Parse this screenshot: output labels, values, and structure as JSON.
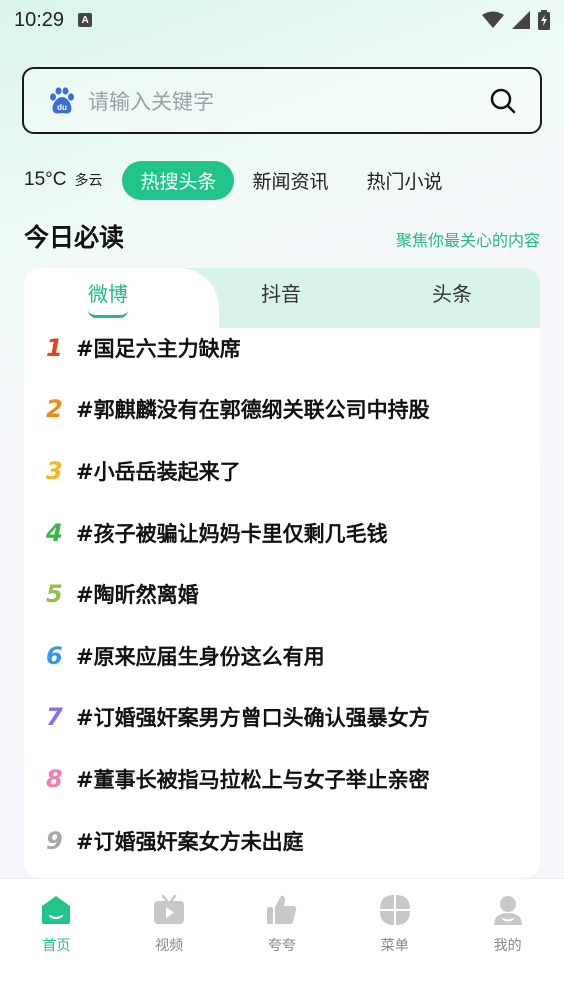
{
  "status": {
    "time": "10:29",
    "notif": "A"
  },
  "search": {
    "placeholder": "请输入关键字"
  },
  "weather": {
    "temp": "15°C",
    "condition": "多云"
  },
  "nav_tabs": [
    "热搜头条",
    "新闻资讯",
    "热门小说"
  ],
  "section": {
    "title": "今日必读",
    "subtitle": "聚焦你最关心的内容"
  },
  "card_tabs": [
    "微博",
    "抖音",
    "头条"
  ],
  "news": [
    {
      "rank": "1",
      "color": "#e8401c",
      "text": "#国足六主力缺席"
    },
    {
      "rank": "2",
      "color": "#f08a17",
      "text": "#郭麒麟没有在郭德纲关联公司中持股"
    },
    {
      "rank": "3",
      "color": "#f3b523",
      "text": "#小岳岳装起来了"
    },
    {
      "rank": "4",
      "color": "#3ab54a",
      "text": "#孩子被骗让妈妈卡里仅剩几毛钱"
    },
    {
      "rank": "5",
      "color": "#8fc24a",
      "text": "#陶昕然离婚"
    },
    {
      "rank": "6",
      "color": "#2f9be8",
      "text": "#原来应届生身份这么有用"
    },
    {
      "rank": "7",
      "color": "#8a6cf0",
      "text": "#订婚强奸案男方曾口头确认强暴女方"
    },
    {
      "rank": "8",
      "color": "#f47ab6",
      "text": "#董事长被指马拉松上与女子举止亲密"
    },
    {
      "rank": "9",
      "color": "#a8a8a8",
      "text": "#订婚强奸案女方未出庭"
    }
  ],
  "bottom_nav": [
    {
      "label": "首页",
      "icon": "home-icon"
    },
    {
      "label": "视频",
      "icon": "tv-icon"
    },
    {
      "label": "夸夸",
      "icon": "thumbs-up-icon"
    },
    {
      "label": "菜单",
      "icon": "grid-menu-icon"
    },
    {
      "label": "我的",
      "icon": "profile-icon"
    }
  ],
  "colors": {
    "accent": "#22c48a",
    "accent_text": "#27b884"
  }
}
